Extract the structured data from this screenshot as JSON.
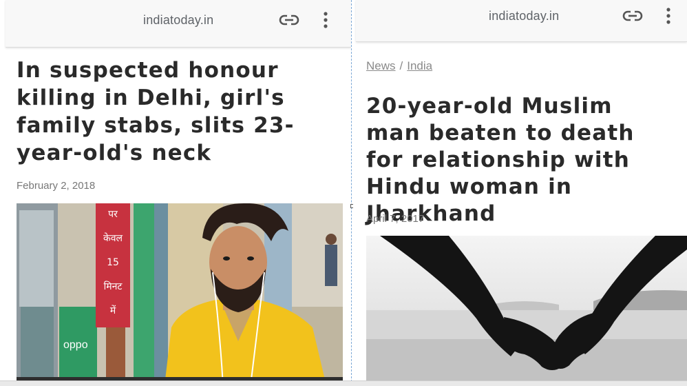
{
  "left_article": {
    "domain": "indiatoday.in",
    "headline": "In suspected honour killing in Delhi, girl's family stabs, slits 23-year-old's neck",
    "date": "February 2, 2018",
    "image_alt": "Young man with styled hair and beard in a yellow shirt in front of a shop"
  },
  "right_article": {
    "domain": "indiatoday.in",
    "breadcrumb": [
      "News",
      "India"
    ],
    "headline": "20-year-old Muslim man beaten to death for relationship with Hindu woman in Jharkhand",
    "date": "April 7, 2017",
    "image_alt": "Silhouette of two hands holding against a grey sea background"
  },
  "shop_sign": {
    "line1": "पर",
    "line2": "केवल",
    "line3": "15",
    "line4": "मिनट",
    "line5": "में",
    "brand": "oppo"
  },
  "icons": {
    "link": "link-icon",
    "menu": "more-vert-icon"
  },
  "colors": {
    "topbar": "#f8f8f8",
    "headline": "#2a2a2a",
    "muted": "#8a8a8a",
    "shirt": "#f2c21c",
    "sign_red": "#c7323f",
    "wall_green": "#2f9a63"
  }
}
